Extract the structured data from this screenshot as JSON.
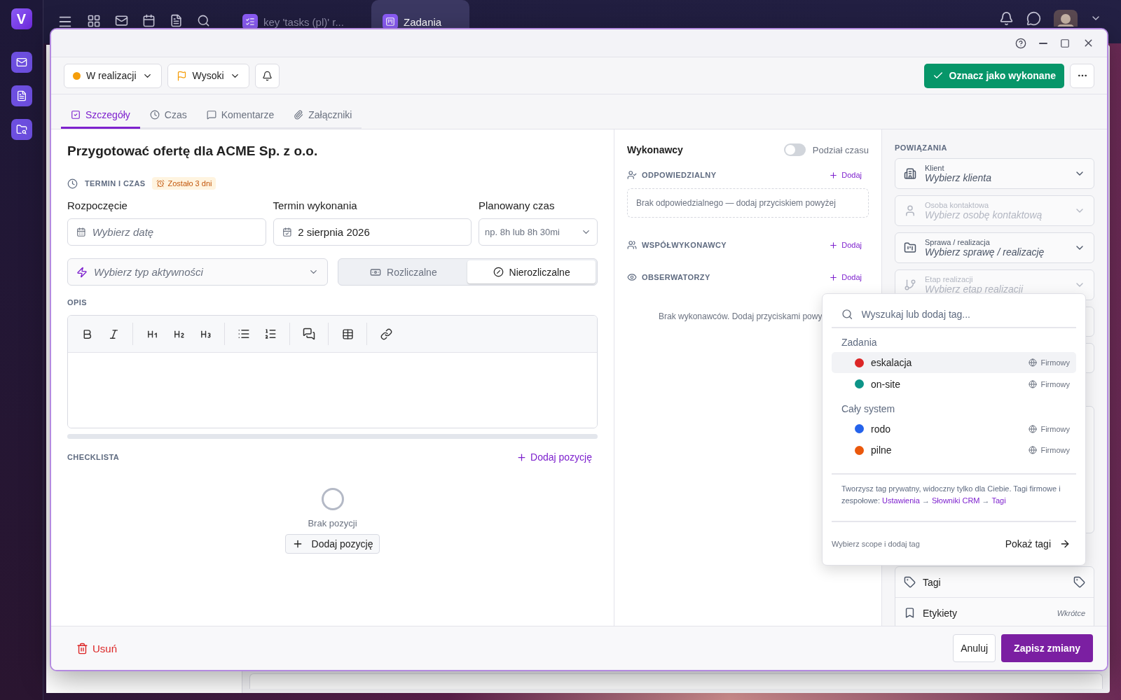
{
  "app": {
    "logo": "V"
  },
  "top_bar": {
    "tabs": [
      {
        "kind": "tasks",
        "label": "key 'tasks (pl)' r...",
        "selected": false
      },
      {
        "kind": "board",
        "label": "Zadania",
        "selected": true
      }
    ]
  },
  "task": {
    "header": {
      "status": {
        "label": "W realizacji",
        "color": "#f59e0b"
      },
      "priority": {
        "label": "Wysoki"
      },
      "complete_button": "Oznacz jako wykonane"
    },
    "tabs": [
      {
        "kind": "details",
        "label": "Szczegóły",
        "selected": true
      },
      {
        "kind": "time",
        "label": "Czas",
        "selected": false
      },
      {
        "kind": "comments",
        "label": "Komentarze",
        "selected": false
      },
      {
        "kind": "attachments",
        "label": "Załączniki",
        "selected": false
      }
    ],
    "title": "Przygotować ofertę dla ACME Sp. z o.o.",
    "schedule": {
      "heading": "TERMIN I CZAS",
      "badge": "Zostało 3 dni",
      "fields": [
        {
          "kind": "date",
          "label": "Rozpoczęcie",
          "placeholder": "Wybierz datę"
        },
        {
          "kind": "date",
          "label": "Termin wykonania",
          "value": "2 sierpnia 2026"
        },
        {
          "kind": "duration",
          "label": "Planowany czas",
          "placeholder": "np. 8h lub 8h 30mi"
        }
      ]
    },
    "activity": {
      "placeholder": "Wybierz typ aktywności"
    },
    "billing": [
      {
        "kind": "billable",
        "label": "Rozliczalne",
        "selected": false
      },
      {
        "kind": "nonbillable",
        "label": "Nierozliczalne",
        "selected": true
      }
    ],
    "description": {
      "heading": "OPIS"
    },
    "checklist": {
      "heading": "CHECKLISTA",
      "add_link": "Dodaj pozycję",
      "empty_text": "Brak pozycji",
      "add_button": "Dodaj pozycję"
    },
    "assignees": {
      "title": "Wykonawcy",
      "split_toggle": {
        "label": "Podział czasu",
        "on": false
      },
      "groups": [
        {
          "kind": "responsible",
          "heading": "ODPOWIEDZIALNY",
          "add": "Dodaj",
          "empty": "Brak odpowiedzialnego — dodaj przyciskiem powyżej"
        },
        {
          "kind": "co",
          "heading": "WSPÓŁWYKONAWCY",
          "add": "Dodaj"
        },
        {
          "kind": "observers",
          "heading": "OBSERWATORZY",
          "add": "Dodaj"
        }
      ],
      "empty_text": "Brak wykonawców. Dodaj przyciskami powy"
    },
    "relations": {
      "heading": "POWIĄZANIA",
      "fields": [
        {
          "kind": "client",
          "label": "Klient",
          "placeholder": "Wybierz klienta",
          "disabled": false
        },
        {
          "kind": "contact",
          "label": "Osoba kontaktowa",
          "placeholder": "Wybierz osobę kontaktową",
          "disabled": true
        },
        {
          "kind": "case",
          "label": "Sprawa / realizacja",
          "placeholder": "Wybierz sprawę / realizację",
          "disabled": false
        },
        {
          "kind": "stage",
          "label": "Etap realizacji",
          "placeholder": "Wybierz etap realizacji",
          "disabled": true
        }
      ],
      "rows": [
        {
          "kind": "tags",
          "label": "Tagi"
        },
        {
          "kind": "labels",
          "label": "Etykiety",
          "note": "Wkrótce"
        }
      ]
    },
    "footer": {
      "delete": "Usuń",
      "cancel": "Anuluj",
      "save": "Zapisz zmiany"
    }
  },
  "tag_picker": {
    "search_placeholder": "Wyszukaj lub dodaj tag...",
    "groups": [
      {
        "title": "Zadania",
        "tags": [
          {
            "name": "eskalacja",
            "color": "#dc2626",
            "scope": "Firmowy",
            "selected": true
          },
          {
            "name": "on-site",
            "color": "#0d9488",
            "scope": "Firmowy",
            "selected": false
          }
        ]
      },
      {
        "title": "Cały system",
        "tags": [
          {
            "name": "rodo",
            "color": "#2563eb",
            "scope": "Firmowy",
            "selected": false
          },
          {
            "name": "pilne",
            "color": "#ea580c",
            "scope": "Firmowy",
            "selected": false
          }
        ]
      }
    ],
    "note": "Tworzysz tag prywatny, widoczny tylko dla Ciebie. Tagi firmowe i zespołowe: ",
    "note_path": [
      "Ustawienia",
      "Słowniki CRM",
      "Tagi"
    ],
    "note_separator": "→",
    "footer_hint": "Wybierz scope i dodaj tag",
    "footer_button": "Pokaż tagi"
  }
}
